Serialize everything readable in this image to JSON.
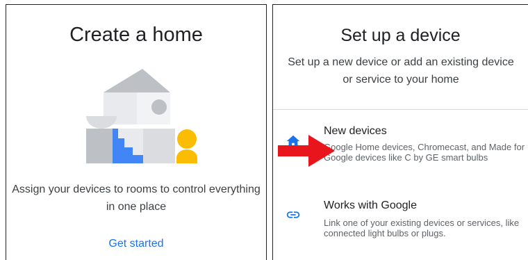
{
  "left_panel": {
    "title": "Create a home",
    "description": "Assign your devices to rooms to control everything in one place",
    "link": "Get started"
  },
  "right_panel": {
    "title": "Set up a device",
    "subtitle": "Set up a new device or add an existing device or service to your home",
    "items": [
      {
        "title": "New devices",
        "description": "Google Home devices, Chromecast, and Made for Google devices like C by GE smart bulbs",
        "icon": "home-icon"
      },
      {
        "title": "Works with Google",
        "description": "Link one of your existing devices or services, like connected light bulbs or plugs.",
        "icon": "link-icon"
      }
    ]
  },
  "colors": {
    "accent_blue": "#1a73e8",
    "arrow_red": "#e8161c",
    "illustration_yellow": "#fbbc04",
    "illustration_gray": "#bdc1c6"
  }
}
